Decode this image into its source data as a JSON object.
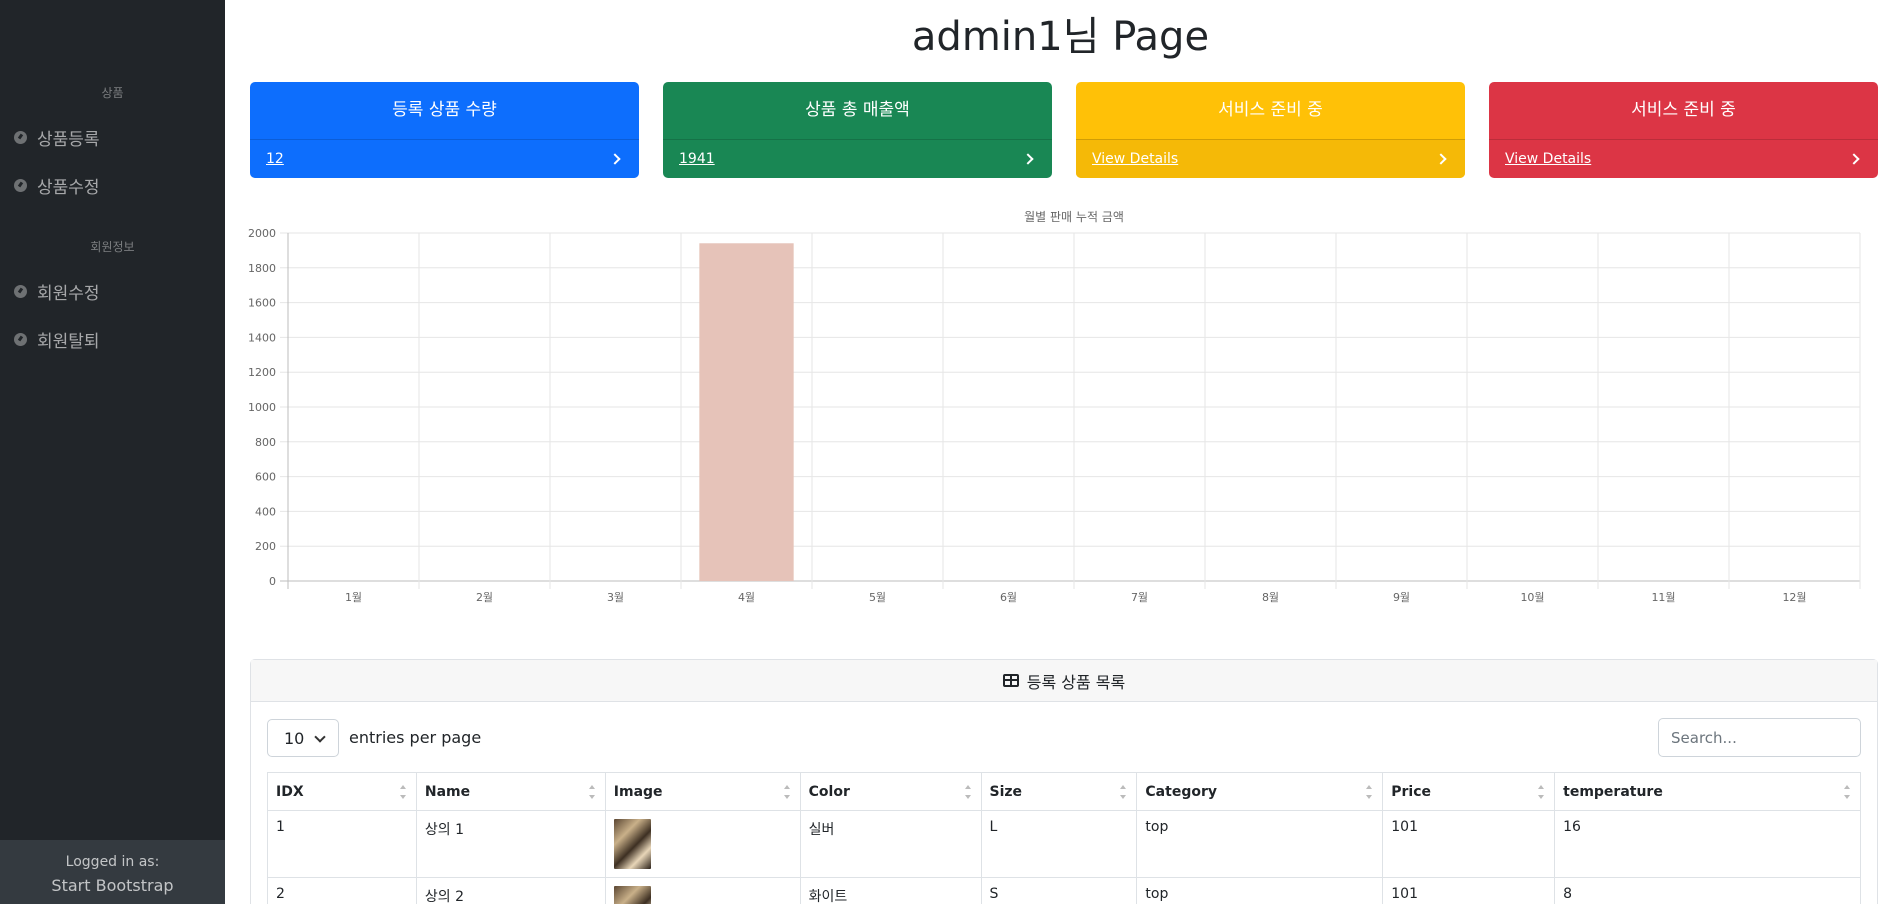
{
  "sidebar": {
    "section_product": "상품",
    "items_product": [
      "상품등록",
      "상품수정"
    ],
    "section_member": "회원정보",
    "items_member": [
      "회원수정",
      "회원탈퇴"
    ],
    "footer_label": "Logged in as:",
    "footer_value": "Start Bootstrap"
  },
  "page_title": "admin1님 Page",
  "cards": [
    {
      "title": "등록 상품 수량",
      "link": "12",
      "color": "#0d6efd"
    },
    {
      "title": "상품 총 매출액",
      "link": "1941",
      "color": "#198754"
    },
    {
      "title": "서비스 준비 중",
      "link": "View Details",
      "color": "#ffc107"
    },
    {
      "title": "서비스 준비 중",
      "link": "View Details",
      "color": "#dc3545"
    }
  ],
  "chart_data": {
    "type": "bar",
    "title": "월별 판매 누적 금액",
    "categories": [
      "1월",
      "2월",
      "3월",
      "4월",
      "5월",
      "6월",
      "7월",
      "8월",
      "9월",
      "10월",
      "11월",
      "12월"
    ],
    "values": [
      0,
      0,
      0,
      1941,
      0,
      0,
      0,
      0,
      0,
      0,
      0,
      0
    ],
    "ylim": [
      0,
      2000
    ],
    "yticks": [
      0,
      200,
      400,
      600,
      800,
      1000,
      1200,
      1400,
      1600,
      1800,
      2000
    ],
    "bar_color": "#e6c3b9",
    "grid": true,
    "xlabel": "",
    "ylabel": ""
  },
  "table_card": {
    "title": "등록 상품 목록",
    "entries_value": "10",
    "entries_label": "entries per page",
    "search_placeholder": "Search...",
    "columns": [
      "IDX",
      "Name",
      "Image",
      "Color",
      "Size",
      "Category",
      "Price",
      "temperature"
    ],
    "rows": [
      {
        "idx": "1",
        "name": "상의 1",
        "color": "실버",
        "size": "L",
        "category": "top",
        "price": "101",
        "temperature": "16"
      },
      {
        "idx": "2",
        "name": "상의 2",
        "color": "화이트",
        "size": "S",
        "category": "top",
        "price": "101",
        "temperature": "8"
      }
    ]
  }
}
